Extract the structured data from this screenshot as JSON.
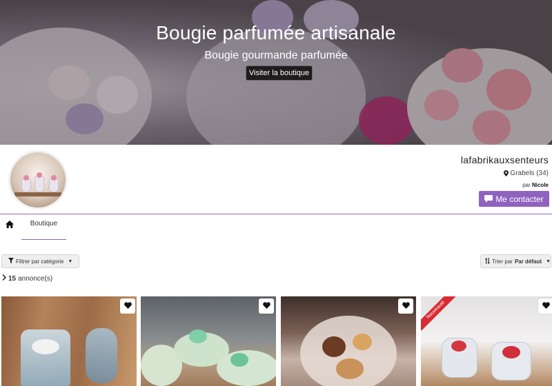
{
  "hero": {
    "title": "Bougie parfumée artisanale",
    "subtitle": "Bougie gourmande parfumée",
    "button": "Visiter la boutique"
  },
  "profile": {
    "shop_name": "lafabrikauxsenteurs",
    "location": "Grabels (34)",
    "owner_prefix": "par",
    "owner_name": "Nicole",
    "contact_button": "Me contacter",
    "accent_color": "#8f62bf"
  },
  "tabs": {
    "home_icon": "home-icon",
    "shop_label": "Boutique"
  },
  "filters": {
    "category_label": "Filtrer par catégorie",
    "sort_prefix": "Trier par",
    "sort_value": "Par défaut"
  },
  "listing_count": {
    "number": "15",
    "label": "annonce(s)"
  },
  "cards": [
    {
      "favorite_icon": "heart-icon"
    },
    {
      "favorite_icon": "heart-icon"
    },
    {
      "favorite_icon": "heart-icon"
    },
    {
      "favorite_icon": "heart-icon",
      "badge": "Nouveauté",
      "badge_color": "#d82b32"
    }
  ]
}
